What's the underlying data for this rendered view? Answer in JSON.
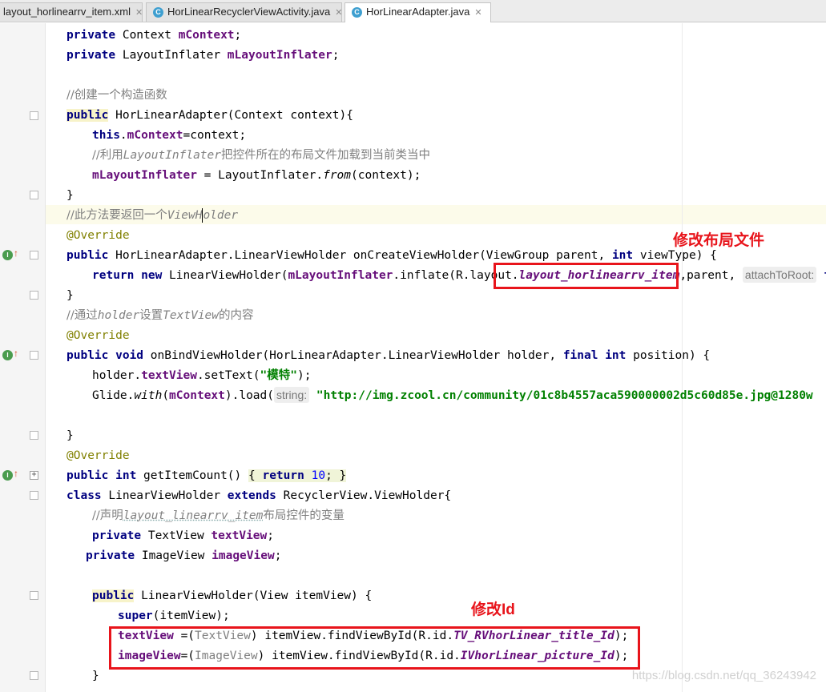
{
  "tabs": [
    {
      "label": "layout_horlinearrv_item.xml",
      "icon": "xml-file-icon"
    },
    {
      "label": "HorLinearRecyclerViewActivity.java",
      "icon": "java-class-icon"
    },
    {
      "label": "HorLinearAdapter.java",
      "icon": "java-class-icon",
      "active": true
    }
  ],
  "tab_close": "✕",
  "class_icon_letter": "C",
  "annotations": {
    "layout_label": "修改布局文件",
    "id_label": "修改Id"
  },
  "watermark": "https://blog.csdn.net/qq_36243942",
  "code": {
    "l1_a": "private",
    "l1_b": " Context ",
    "l1_c": "mContext",
    "l1_d": ";",
    "l2_a": "private",
    "l2_b": " LayoutInflater ",
    "l2_c": "mLayoutInflater",
    "l2_d": ";",
    "l4": "//创建一个构造函数",
    "l5_a": "public",
    "l5_b": " HorLinearAdapter(Context context){",
    "l6_a": "this",
    "l6_b": ".",
    "l6_c": "mContext",
    "l6_d": "=context;",
    "l7_a": "//利用",
    "l7_b": "LayoutInflater",
    "l7_c": "把控件所在的布局文件加载到当前类当中",
    "l8_a": "mLayoutInflater",
    "l8_b": " = LayoutInflater.",
    "l8_c": "from",
    "l8_d": "(context);",
    "l9": "}",
    "l10_a": "//此方法要返回一个",
    "l10_b1": "ViewH",
    "l10_b2": "older",
    "l11": "@Override",
    "l12_a": "public",
    "l12_b": " HorLinearAdapter.LinearViewHolder onCreateViewHolder(ViewGroup parent, ",
    "l12_c": "int",
    "l12_d": " viewType) {",
    "l13_a": "return new",
    "l13_b": " LinearViewHolder(",
    "l13_c": "mLayoutInflater",
    "l13_d": ".inflate(R.layout.",
    "l13_e": "layout_horlinearrv_item",
    "l13_f": ",parent, ",
    "l13_hint": "attachToRoot:",
    "l13_g": " fa",
    "l14": "}",
    "l15_a": "//通过",
    "l15_b": "holder",
    "l15_c": "设置",
    "l15_d": "TextView",
    "l15_e": "的内容",
    "l16": "@Override",
    "l17_a": "public void",
    "l17_b": " onBindViewHolder(HorLinearAdapter.LinearViewHolder holder, ",
    "l17_c": "final int",
    "l17_d": " position) {",
    "l18_a": "holder.",
    "l18_b": "textView",
    "l18_c": ".setText(",
    "l18_d": "\"模特\"",
    "l18_e": ");",
    "l19_a": "Glide.",
    "l19_b": "with",
    "l19_c": "(",
    "l19_d": "mContext",
    "l19_e": ").load(",
    "l19_hint": "string:",
    "l19_f": " \"http://img.zcool.cn/community/01c8b4557aca590000002d5c60d85e.jpg@1280w",
    "l21": "}",
    "l22": "@Override",
    "l23_a": "public int",
    "l23_b": " getItemCount() ",
    "l23_c": "{ ",
    "l23_d": "return",
    "l23_e": " 10",
    "l23_f": "; }",
    "l24_a": "class",
    "l24_b": " LinearViewHolder ",
    "l24_c": "extends",
    "l24_d": " RecyclerView.ViewHolder{",
    "l25_a": "//声明",
    "l25_b": "layout_linearrv_item",
    "l25_c": "布局控件的变量",
    "l26_a": "private",
    "l26_b": " TextView ",
    "l26_c": "textView",
    "l26_d": ";",
    "l27_a": "private",
    "l27_b": " ImageView ",
    "l27_c": "imageView",
    "l27_d": ";",
    "l29_a": "public",
    "l29_b": " LinearViewHolder(View itemView) {",
    "l30_a": "super",
    "l30_b": "(itemView);",
    "l31_a": "textView",
    "l31_b": " =(",
    "l31_c": "TextView",
    "l31_d": ") itemView.findViewById(R.id.",
    "l31_e": "TV_RVhorLinear_title_Id",
    "l31_f": ");",
    "l32_a": "imageView",
    "l32_b": "=(",
    "l32_c": "ImageView",
    "l32_d": ") itemView.findViewById(R.id.",
    "l32_e": "IVhorLinear_picture_Id",
    "l32_f": ");",
    "l33": "}"
  }
}
